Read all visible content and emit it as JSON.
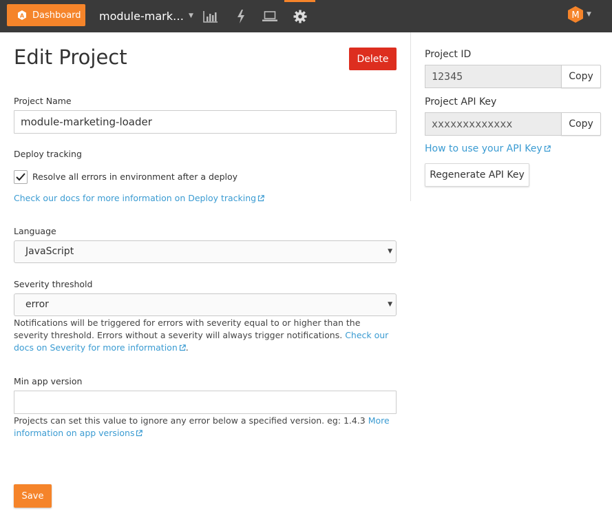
{
  "nav": {
    "dashboard_label": "Dashboard",
    "project_name": "module-mark…",
    "icons": [
      "dashboard-logo-icon",
      "bar-chart-icon",
      "lightning-icon",
      "laptop-icon",
      "gear-icon"
    ],
    "avatar_initial": "M",
    "accent": "#f5842a"
  },
  "page": {
    "title": "Edit Project",
    "delete_label": "Delete",
    "project_name_label": "Project Name",
    "project_name_value": "module-marketing-loader",
    "deploy_tracking_label": "Deploy tracking",
    "resolve_checkbox_label": "Resolve all errors in environment after a deploy",
    "resolve_checked": true,
    "deploy_docs_link": "Check our docs for more information on Deploy tracking",
    "language_label": "Language",
    "language_value": "JavaScript",
    "severity_label": "Severity threshold",
    "severity_value": "error",
    "severity_help_text": "Notifications will be triggered for errors with severity equal to or higher than the severity threshold. Errors without a severity will always trigger notifications.",
    "severity_help_link": "Check our docs on Severity for more information",
    "severity_help_end": ".",
    "min_app_version_label": "Min app version",
    "min_app_version_value": "",
    "min_app_help_text": "Projects can set this value to ignore any error below a specified version. eg: 1.4.3",
    "min_app_help_link": "More information on app versions",
    "save_label": "Save"
  },
  "side": {
    "project_id_label": "Project ID",
    "project_id_value": "12345",
    "api_key_label": "Project API Key",
    "api_key_value": "xxxxxxxxxxxxx",
    "copy_label": "Copy",
    "api_help_link": "How to use your API Key",
    "regenerate_label": "Regenerate API Key"
  }
}
